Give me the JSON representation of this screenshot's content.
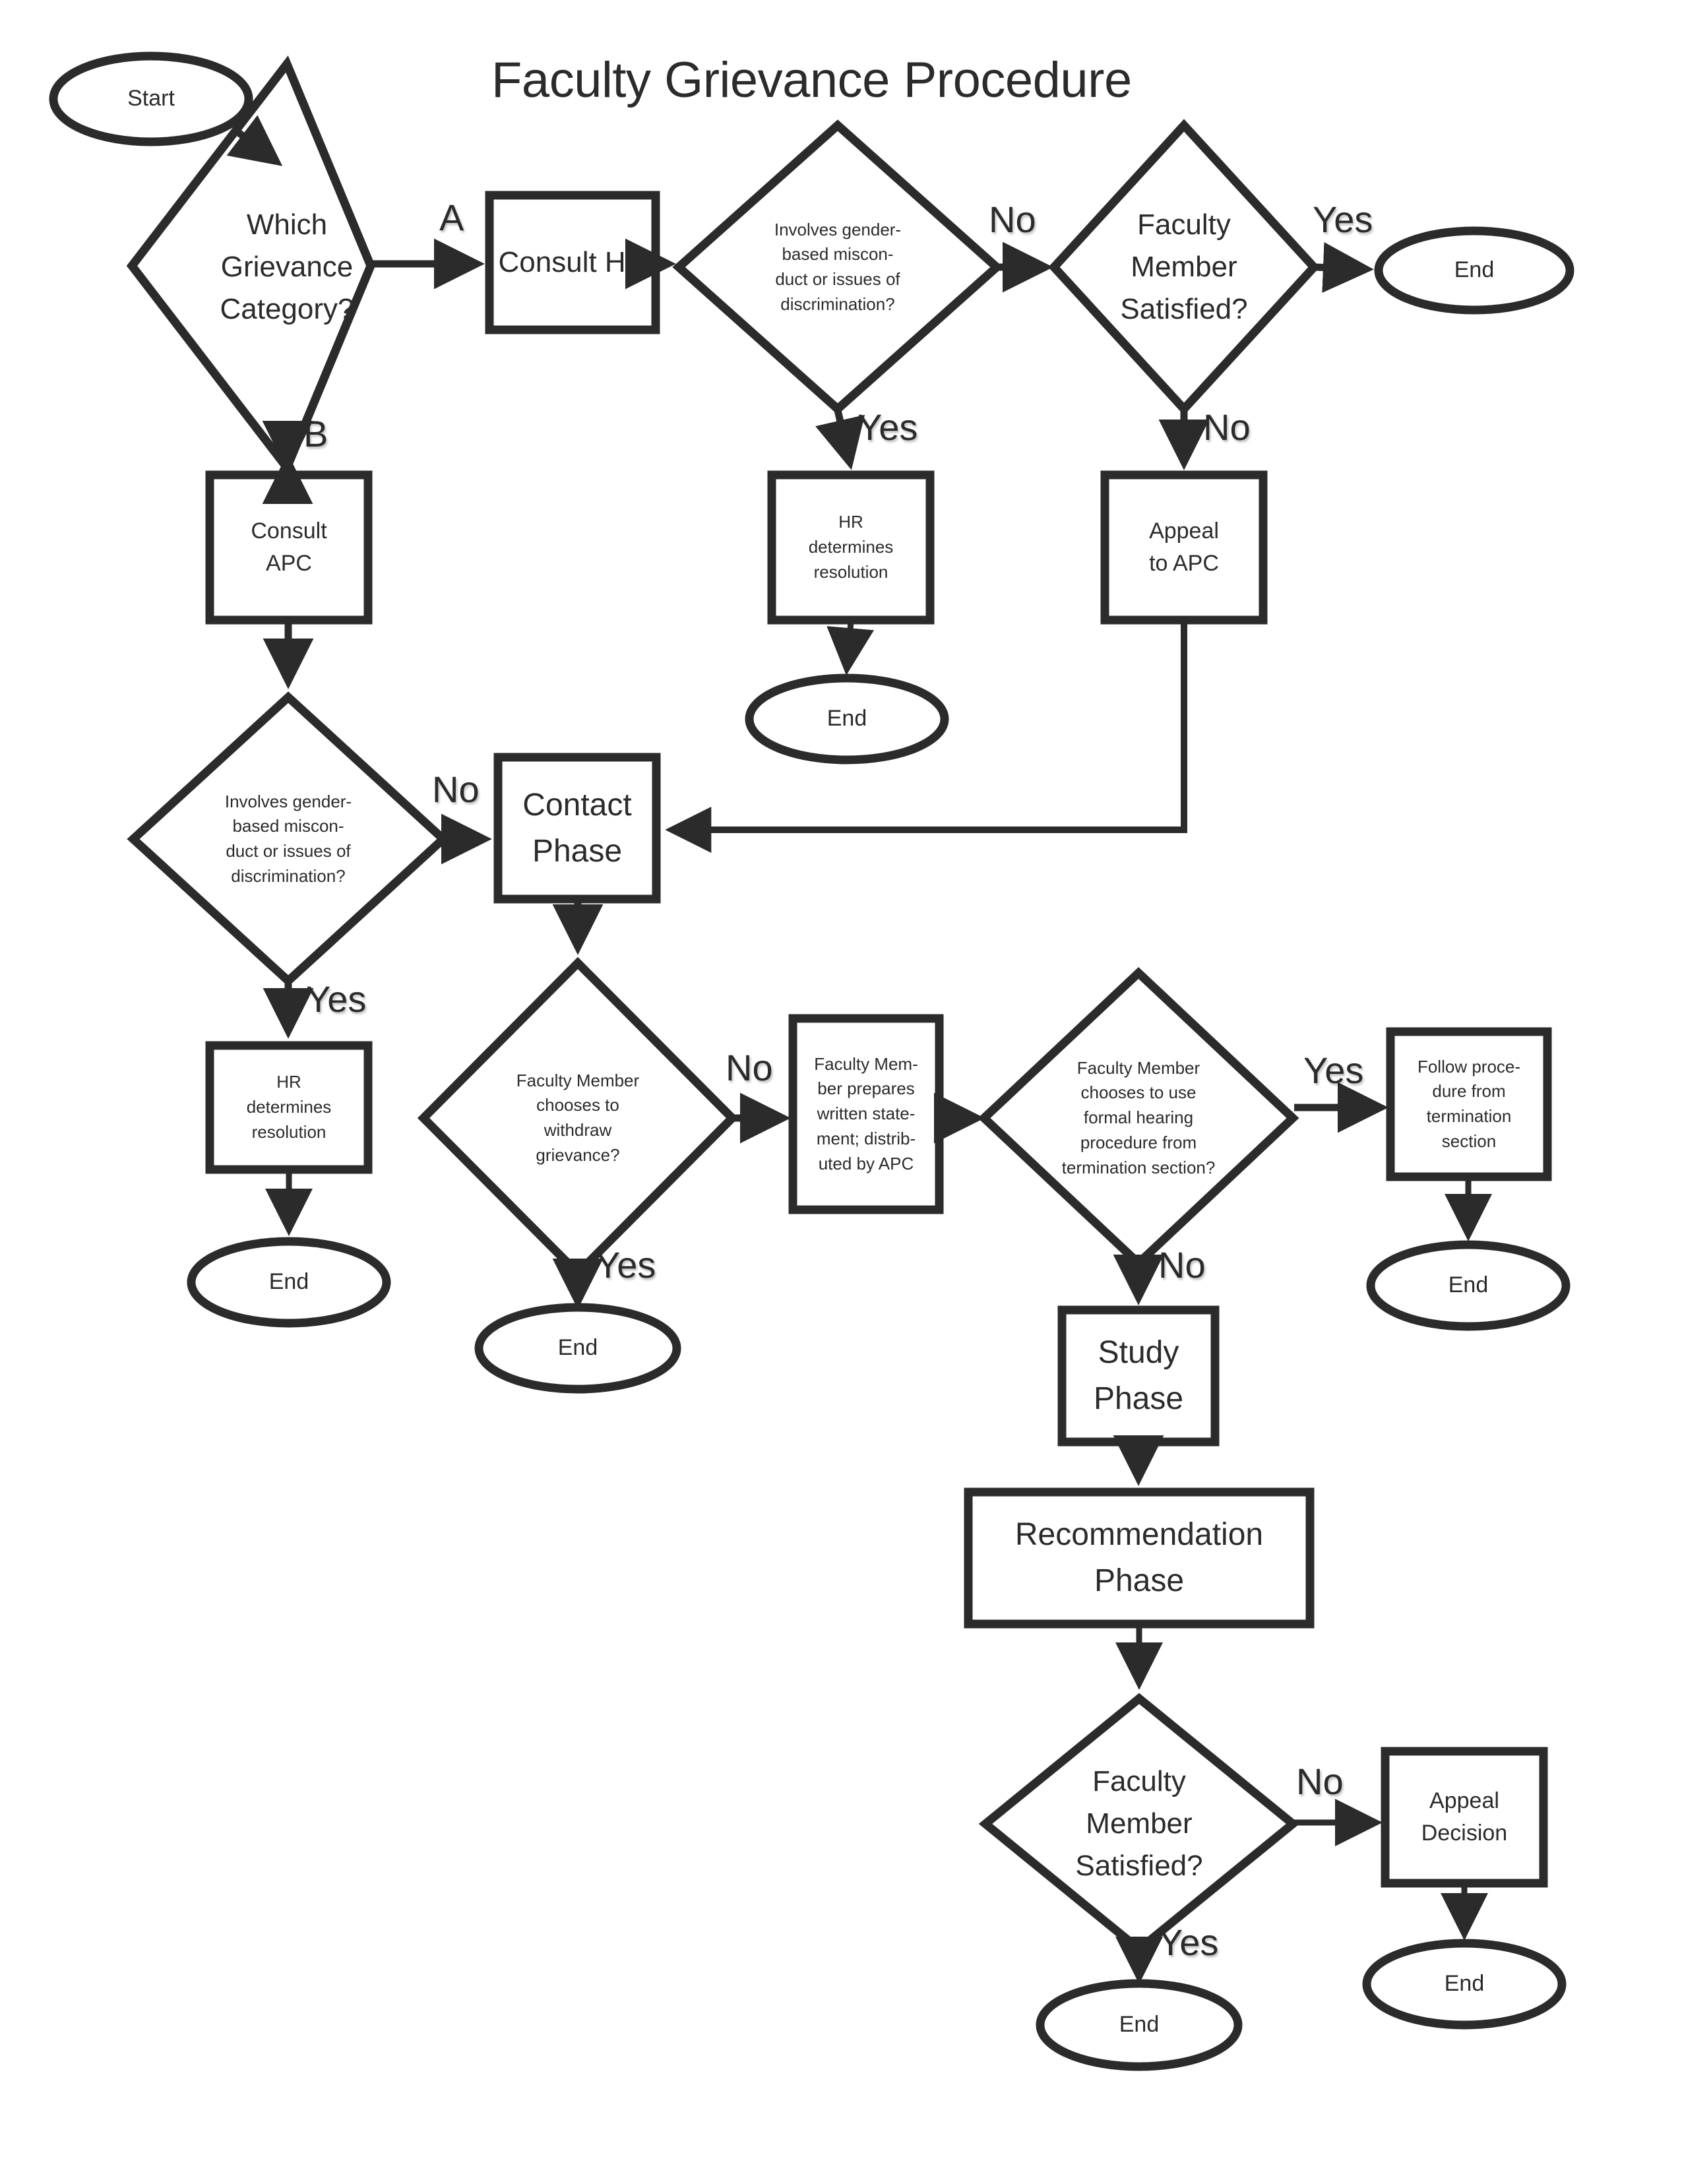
{
  "title": "Faculty Grievance Procedure",
  "colors": {
    "stroke": "#2b2b2b",
    "fill": "#ffffff",
    "text": "#2b2b2b"
  },
  "nodes": {
    "start": {
      "label": "Start",
      "shape": "ellipse"
    },
    "which_category": {
      "label": "Which\nGrievance\nCategory?",
      "shape": "diamond"
    },
    "consult_hr": {
      "label": "Consult HR",
      "shape": "process"
    },
    "hr_gender_question": {
      "label": "Involves gender-\nbased miscon-\nduct or issues of\ndiscrimination?",
      "shape": "diamond"
    },
    "hr_satisfied": {
      "label": "Faculty\nMember\nSatisfied?",
      "shape": "diamond"
    },
    "end_hr_satisfied": {
      "label": "End",
      "shape": "ellipse"
    },
    "hr_determines_resolution_top": {
      "label": "HR\ndetermines\nresolution",
      "shape": "process"
    },
    "end_hr_resolution_top": {
      "label": "End",
      "shape": "ellipse"
    },
    "appeal_to_apc": {
      "label": "Appeal\nto APC",
      "shape": "process"
    },
    "consult_apc": {
      "label": "Consult\nAPC",
      "shape": "process"
    },
    "apc_gender_question": {
      "label": "Involves gender-\nbased miscon-\nduct or issues of\ndiscrimination?",
      "shape": "diamond"
    },
    "hr_determines_resolution_left": {
      "label": "HR\ndetermines\nresolution",
      "shape": "process"
    },
    "end_hr_resolution_left": {
      "label": "End",
      "shape": "ellipse"
    },
    "contact_phase": {
      "label": "Contact\nPhase",
      "shape": "process"
    },
    "withdraw_question": {
      "label": "Faculty Member\nchooses to\nwithdraw\ngrievance?",
      "shape": "diamond"
    },
    "end_withdraw": {
      "label": "End",
      "shape": "ellipse"
    },
    "written_statement": {
      "label": "Faculty Mem-\nber prepares\nwritten state-\nment; distrib-\nuted by APC",
      "shape": "process"
    },
    "formal_hearing_question": {
      "label": "Faculty Member\nchooses to use\nformal hearing\nprocedure from\ntermination section?",
      "shape": "diamond"
    },
    "follow_termination": {
      "label": "Follow proce-\ndure from\ntermination\nsection",
      "shape": "process"
    },
    "end_termination": {
      "label": "End",
      "shape": "ellipse"
    },
    "study_phase": {
      "label": "Study\nPhase",
      "shape": "process"
    },
    "recommendation_phase": {
      "label": "Recommendation\nPhase",
      "shape": "process"
    },
    "final_satisfied": {
      "label": "Faculty\nMember\nSatisfied?",
      "shape": "diamond"
    },
    "end_final_satisfied": {
      "label": "End",
      "shape": "ellipse"
    },
    "appeal_decision": {
      "label": "Appeal\nDecision",
      "shape": "process"
    },
    "end_appeal_decision": {
      "label": "End",
      "shape": "ellipse"
    }
  },
  "edge_labels": {
    "cat_a": "A",
    "cat_b": "B",
    "hr_gender_no": "No",
    "hr_gender_yes": "Yes",
    "hr_satisfied_yes": "Yes",
    "hr_satisfied_no": "No",
    "apc_gender_no": "No",
    "apc_gender_yes": "Yes",
    "withdraw_no": "No",
    "withdraw_yes": "Yes",
    "formal_hearing_yes": "Yes",
    "formal_hearing_no": "No",
    "final_satisfied_no": "No",
    "final_satisfied_yes": "Yes"
  },
  "chart_data": {
    "type": "diagram",
    "diagram_type": "flowchart",
    "title": "Faculty Grievance Procedure",
    "nodes": [
      {
        "id": "start",
        "label": "Start",
        "shape": "ellipse"
      },
      {
        "id": "which_category",
        "label": "Which Grievance Category?",
        "shape": "diamond"
      },
      {
        "id": "consult_hr",
        "label": "Consult HR",
        "shape": "process"
      },
      {
        "id": "hr_gender_question",
        "label": "Involves gender-based misconduct or issues of discrimination?",
        "shape": "diamond"
      },
      {
        "id": "hr_satisfied",
        "label": "Faculty Member Satisfied?",
        "shape": "diamond"
      },
      {
        "id": "end_hr_satisfied",
        "label": "End",
        "shape": "ellipse"
      },
      {
        "id": "hr_determines_resolution_top",
        "label": "HR determines resolution",
        "shape": "process"
      },
      {
        "id": "end_hr_resolution_top",
        "label": "End",
        "shape": "ellipse"
      },
      {
        "id": "appeal_to_apc",
        "label": "Appeal to APC",
        "shape": "process"
      },
      {
        "id": "consult_apc",
        "label": "Consult APC",
        "shape": "process"
      },
      {
        "id": "apc_gender_question",
        "label": "Involves gender-based misconduct or issues of discrimination?",
        "shape": "diamond"
      },
      {
        "id": "hr_determines_resolution_left",
        "label": "HR determines resolution",
        "shape": "process"
      },
      {
        "id": "end_hr_resolution_left",
        "label": "End",
        "shape": "ellipse"
      },
      {
        "id": "contact_phase",
        "label": "Contact Phase",
        "shape": "process"
      },
      {
        "id": "withdraw_question",
        "label": "Faculty Member chooses to withdraw grievance?",
        "shape": "diamond"
      },
      {
        "id": "end_withdraw",
        "label": "End",
        "shape": "ellipse"
      },
      {
        "id": "written_statement",
        "label": "Faculty Member prepares written statement; distributed by APC",
        "shape": "process"
      },
      {
        "id": "formal_hearing_question",
        "label": "Faculty Member chooses to use formal hearing procedure from termination section?",
        "shape": "diamond"
      },
      {
        "id": "follow_termination",
        "label": "Follow procedure from termination section",
        "shape": "process"
      },
      {
        "id": "end_termination",
        "label": "End",
        "shape": "ellipse"
      },
      {
        "id": "study_phase",
        "label": "Study Phase",
        "shape": "process"
      },
      {
        "id": "recommendation_phase",
        "label": "Recommendation Phase",
        "shape": "process"
      },
      {
        "id": "final_satisfied",
        "label": "Faculty Member Satisfied?",
        "shape": "diamond"
      },
      {
        "id": "end_final_satisfied",
        "label": "End",
        "shape": "ellipse"
      },
      {
        "id": "appeal_decision",
        "label": "Appeal Decision",
        "shape": "process"
      },
      {
        "id": "end_appeal_decision",
        "label": "End",
        "shape": "ellipse"
      }
    ],
    "edges": [
      {
        "from": "start",
        "to": "which_category",
        "label": ""
      },
      {
        "from": "which_category",
        "to": "consult_hr",
        "label": "A"
      },
      {
        "from": "which_category",
        "to": "consult_apc",
        "label": "B"
      },
      {
        "from": "consult_hr",
        "to": "hr_gender_question",
        "label": ""
      },
      {
        "from": "hr_gender_question",
        "to": "hr_satisfied",
        "label": "No"
      },
      {
        "from": "hr_gender_question",
        "to": "hr_determines_resolution_top",
        "label": "Yes"
      },
      {
        "from": "hr_determines_resolution_top",
        "to": "end_hr_resolution_top",
        "label": ""
      },
      {
        "from": "hr_satisfied",
        "to": "end_hr_satisfied",
        "label": "Yes"
      },
      {
        "from": "hr_satisfied",
        "to": "appeal_to_apc",
        "label": "No"
      },
      {
        "from": "appeal_to_apc",
        "to": "contact_phase",
        "label": ""
      },
      {
        "from": "consult_apc",
        "to": "apc_gender_question",
        "label": ""
      },
      {
        "from": "apc_gender_question",
        "to": "contact_phase",
        "label": "No"
      },
      {
        "from": "apc_gender_question",
        "to": "hr_determines_resolution_left",
        "label": "Yes"
      },
      {
        "from": "hr_determines_resolution_left",
        "to": "end_hr_resolution_left",
        "label": ""
      },
      {
        "from": "contact_phase",
        "to": "withdraw_question",
        "label": ""
      },
      {
        "from": "withdraw_question",
        "to": "end_withdraw",
        "label": "Yes"
      },
      {
        "from": "withdraw_question",
        "to": "written_statement",
        "label": "No"
      },
      {
        "from": "written_statement",
        "to": "formal_hearing_question",
        "label": ""
      },
      {
        "from": "formal_hearing_question",
        "to": "follow_termination",
        "label": "Yes"
      },
      {
        "from": "formal_hearing_question",
        "to": "study_phase",
        "label": "No"
      },
      {
        "from": "follow_termination",
        "to": "end_termination",
        "label": ""
      },
      {
        "from": "study_phase",
        "to": "recommendation_phase",
        "label": ""
      },
      {
        "from": "recommendation_phase",
        "to": "final_satisfied",
        "label": ""
      },
      {
        "from": "final_satisfied",
        "to": "end_final_satisfied",
        "label": "Yes"
      },
      {
        "from": "final_satisfied",
        "to": "appeal_decision",
        "label": "No"
      },
      {
        "from": "appeal_decision",
        "to": "end_appeal_decision",
        "label": ""
      }
    ]
  }
}
